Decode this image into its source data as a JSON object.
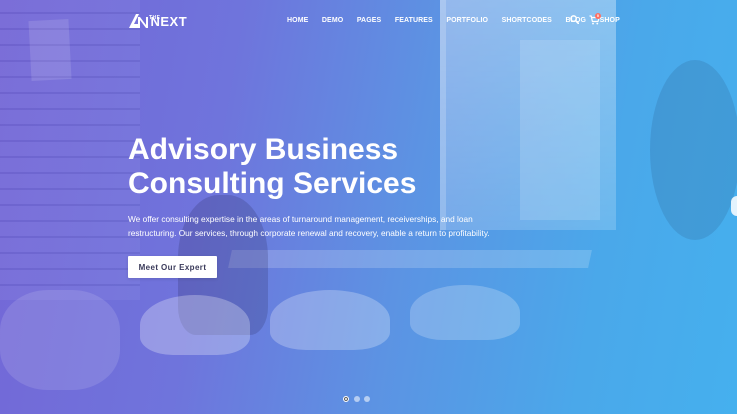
{
  "logo": {
    "the": "THE",
    "next": "NEXT",
    "mark": "nv-logo-icon"
  },
  "nav": {
    "items": [
      {
        "label": "HOME"
      },
      {
        "label": "DEMO"
      },
      {
        "label": "PAGES"
      },
      {
        "label": "FEATURES"
      },
      {
        "label": "PORTFOLIO"
      },
      {
        "label": "SHORTCODES"
      },
      {
        "label": "BLOG"
      },
      {
        "label": "SHOP"
      }
    ],
    "search_icon": "search-icon",
    "cart_icon": "cart-icon",
    "cart_count": "0"
  },
  "hero": {
    "title_line1": "Advisory Business",
    "title_line2": "Consulting Services",
    "desc_line1": "We offer consulting expertise in the areas of turnaround management, receiverships, and loan",
    "desc_line2": "restructuring. Our services, through corporate renewal and recovery, enable a return to profitability.",
    "cta_label": "Meet Our Expert"
  },
  "slider": {
    "dots": 3,
    "active_index": 0
  },
  "colors": {
    "gradient_left": "#7466d6",
    "gradient_right": "#45b0ee",
    "cart_badge": "#ff6f61",
    "cta_text": "#3a3a5a"
  }
}
